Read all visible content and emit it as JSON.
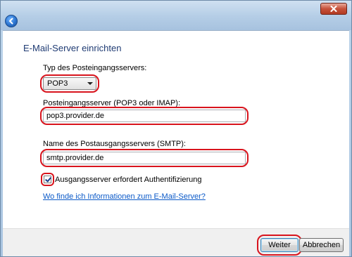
{
  "window": {
    "heading": "E-Mail-Server einrichten"
  },
  "form": {
    "incoming_type_label": "Typ des Posteingangsservers:",
    "incoming_type_value": "POP3",
    "incoming_server_label": "Posteingangsserver (POP3 oder IMAP):",
    "incoming_server_value": "pop3.provider.de",
    "outgoing_server_label": "Name des Postausgangsservers (SMTP):",
    "outgoing_server_value": "smtp.provider.de",
    "auth_checkbox_label": "Ausgangsserver erfordert Authentifizierung",
    "auth_checked": true,
    "help_link": "Wo finde ich Informationen zum E-Mail-Server?"
  },
  "buttons": {
    "next": "Weiter",
    "cancel": "Abbrechen"
  },
  "colors": {
    "highlight_ring": "#d8141d",
    "heading": "#1f3b73",
    "link": "#0a59c8"
  }
}
